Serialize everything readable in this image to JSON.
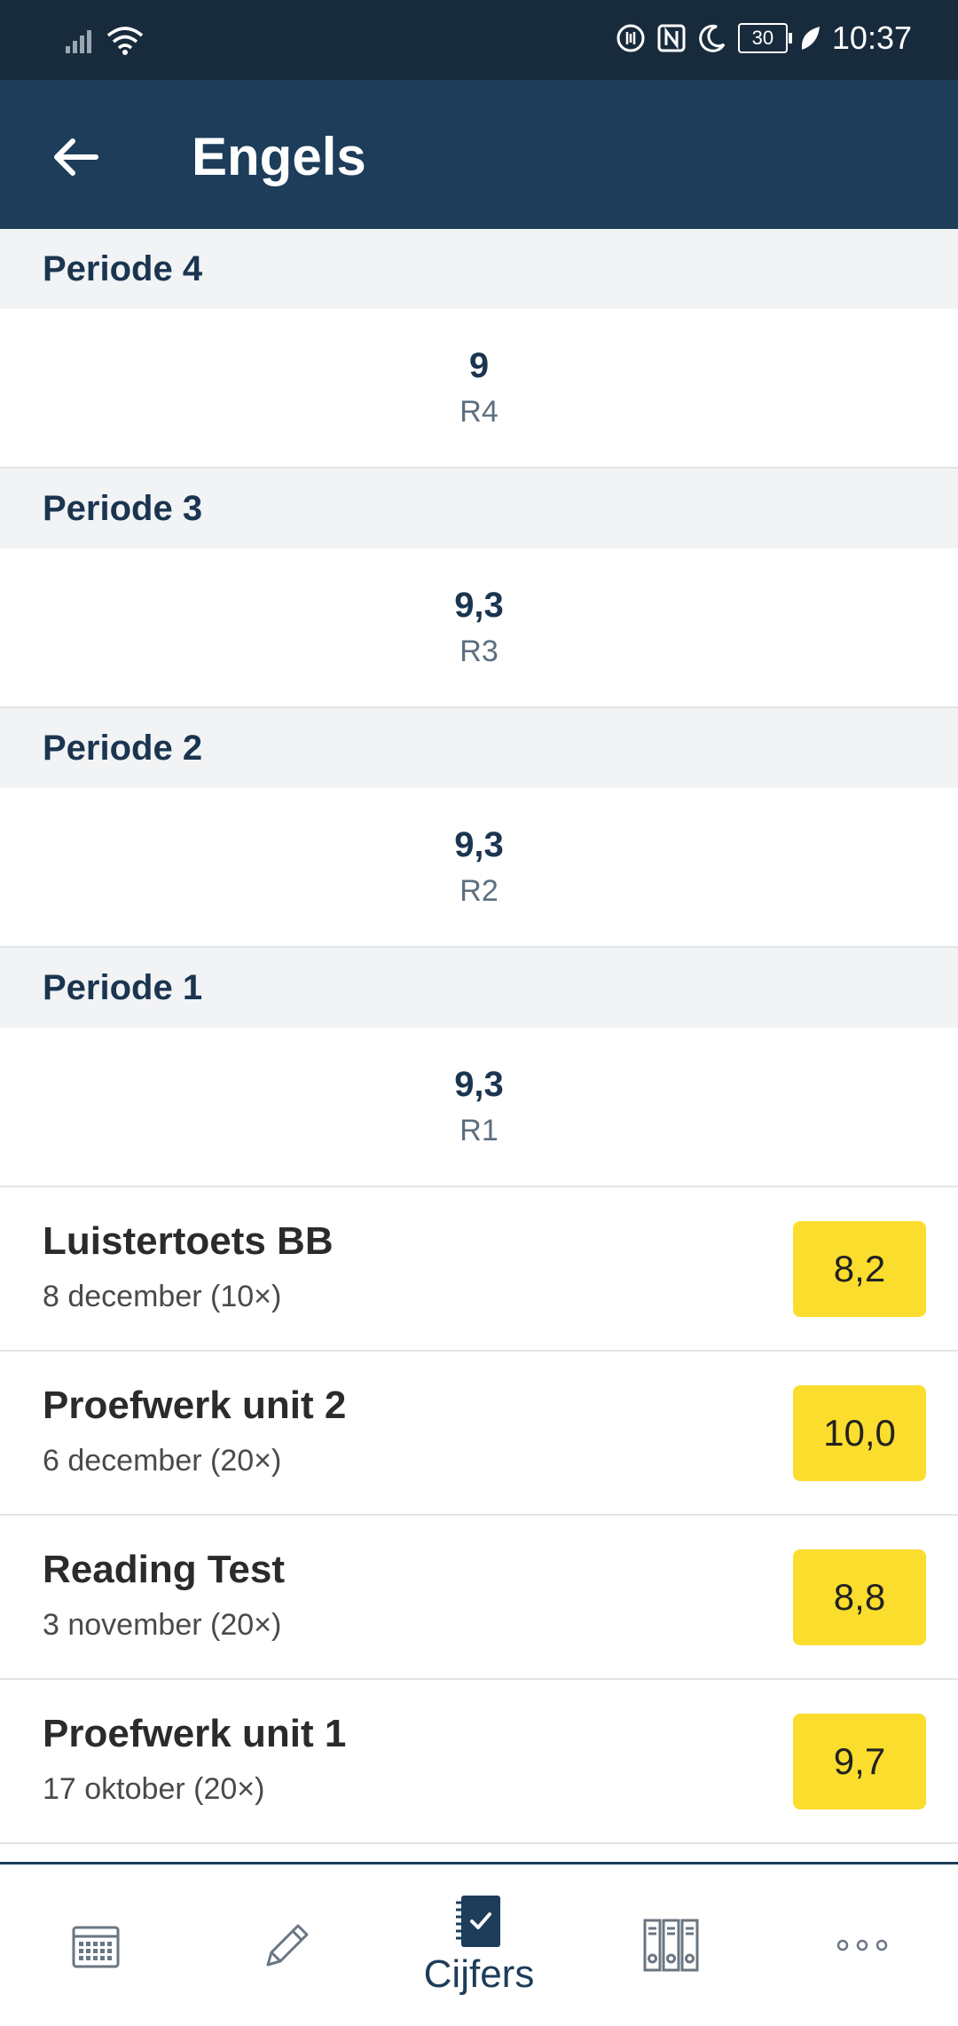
{
  "status": {
    "time": "10:37",
    "battery": "30"
  },
  "header": {
    "title": "Engels"
  },
  "periods": [
    {
      "label": "Periode 4",
      "grade": "9",
      "code": "R4"
    },
    {
      "label": "Periode 3",
      "grade": "9,3",
      "code": "R3"
    },
    {
      "label": "Periode 2",
      "grade": "9,3",
      "code": "R2"
    },
    {
      "label": "Periode 1",
      "grade": "9,3",
      "code": "R1"
    }
  ],
  "grades": [
    {
      "name": "Luistertoets BB",
      "meta": "8 december (10×)",
      "value": "8,2"
    },
    {
      "name": "Proefwerk unit 2",
      "meta": "6 december (20×)",
      "value": "10,0"
    },
    {
      "name": "Reading Test",
      "meta": "3 november (20×)",
      "value": "8,8"
    },
    {
      "name": "Proefwerk unit 1",
      "meta": "17 oktober (20×)",
      "value": "9,7"
    }
  ],
  "nav": {
    "items": [
      {
        "icon": "calendar-icon"
      },
      {
        "icon": "pencil-icon"
      },
      {
        "icon": "grades-notebook-icon",
        "label": "Cijfers",
        "active": true
      },
      {
        "icon": "binders-icon"
      },
      {
        "icon": "more-icon"
      }
    ]
  },
  "colors": {
    "header": "#1d3d5a",
    "statusbar": "#182b3c",
    "badge": "#fbdd2d"
  }
}
